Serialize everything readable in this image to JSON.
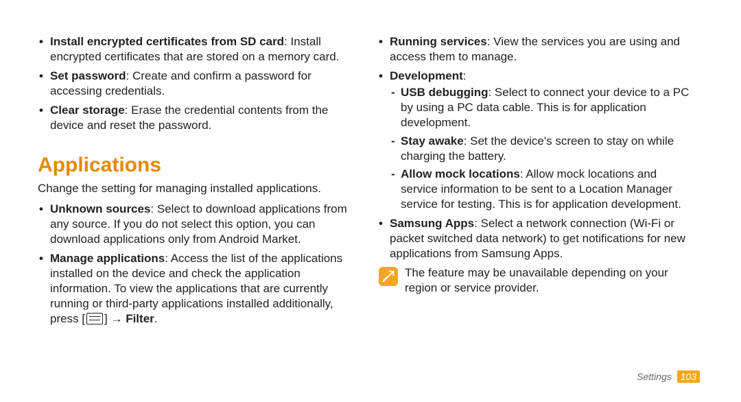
{
  "left": {
    "items": [
      {
        "title": "Install encrypted certificates from SD card",
        "desc": ": Install encrypted certificates that are stored on a memory card."
      },
      {
        "title": "Set password",
        "desc": ": Create and confirm a password for accessing credentials."
      },
      {
        "title": "Clear storage",
        "desc": ": Erase the credential contents from the device and reset the password."
      }
    ],
    "heading": "Applications",
    "intro": "Change the setting for managing installed applications.",
    "apps": [
      {
        "title": "Unknown sources",
        "desc": ": Select to download applications from any source. If you do not select this option, you can download applications only from Android Market."
      },
      {
        "title": "Manage applications",
        "desc_pre": ": Access the list of the applications installed on the device and check the application information. To view the applications that are currently running or third-party applications installed additionally, press [",
        "desc_post": "] → ",
        "filter": "Filter",
        "desc_end": "."
      }
    ]
  },
  "right": {
    "items": [
      {
        "title": "Running services",
        "desc": ": View the services you are using and access them to manage."
      },
      {
        "title": "Development",
        "desc": ":",
        "subs": [
          {
            "title": "USB debugging",
            "desc": ": Select to connect your device to a PC by using a PC data cable. This is for application development."
          },
          {
            "title": "Stay awake",
            "desc": ": Set the device's screen to stay on while charging the battery."
          },
          {
            "title": "Allow mock locations",
            "desc": ": Allow mock locations and service information to be sent to a Location Manager service for testing. This is for application development."
          }
        ]
      },
      {
        "title": "Samsung Apps",
        "desc": ": Select a network connection (Wi-Fi or packet switched data network) to get notifications for new applications from Samsung Apps."
      }
    ],
    "note": "The feature may be unavailable depending on your region or service provider."
  },
  "footer": {
    "section": "Settings",
    "page": "103"
  }
}
